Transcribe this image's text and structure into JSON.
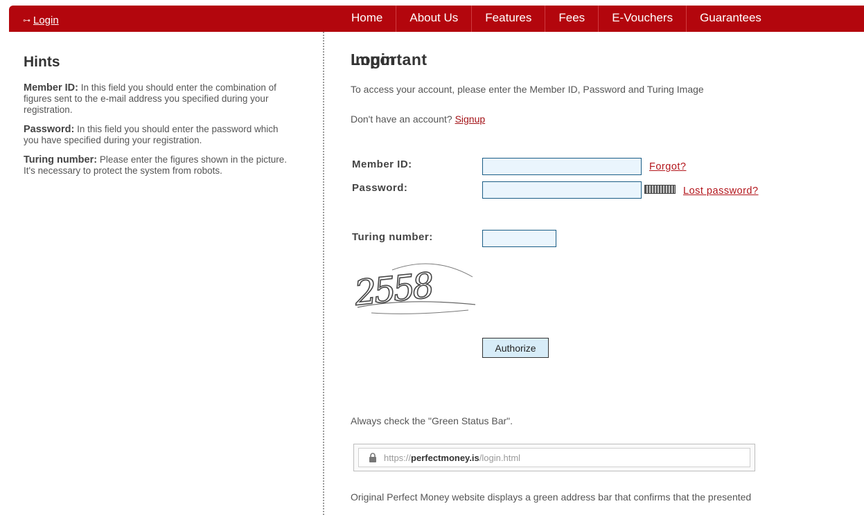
{
  "topbar": {
    "login_label": "Login",
    "nav": [
      "Home",
      "About Us",
      "Features",
      "Fees",
      "E-Vouchers",
      "Guarantees"
    ]
  },
  "hints": {
    "title": "Hints",
    "member_id_term": "Member ID:",
    "member_id_text": " In this field you should enter the combination of figures sent to the e-mail address you specified during your registration.",
    "password_term": "Password:",
    "password_text": " In this field you should enter the password which you have specified during your registration.",
    "turing_term": "Turing number:",
    "turing_text": " Please enter the figures shown in the picture. It's necessary to protect the system from robots."
  },
  "main": {
    "title": "Login",
    "intro": "To access your account, please enter the Member ID, Password and Turing Image",
    "no_account": "Don't have an account?",
    "signup": "Signup",
    "member_id_label": "Member ID:",
    "member_id_value": "",
    "forgot": "Forgot?",
    "password_label": "Password:",
    "password_value": "",
    "lost_password": "Lost password?",
    "turing_label": "Turing number:",
    "turing_value": "",
    "captcha_text": "2558",
    "authorize": "Authorize",
    "important_title": "Important",
    "green_bar_note": "Always check the \"Green Status Bar\".",
    "url_scheme": "https://",
    "url_domain": "perfectmoney.is",
    "url_path": "/login.html",
    "original_note": "Original Perfect Money website displays a green address bar that confirms that the presented"
  },
  "colors": {
    "brand_red": "#b3060d",
    "input_bg": "#eaf5fd",
    "link_red": "#b3161c"
  }
}
